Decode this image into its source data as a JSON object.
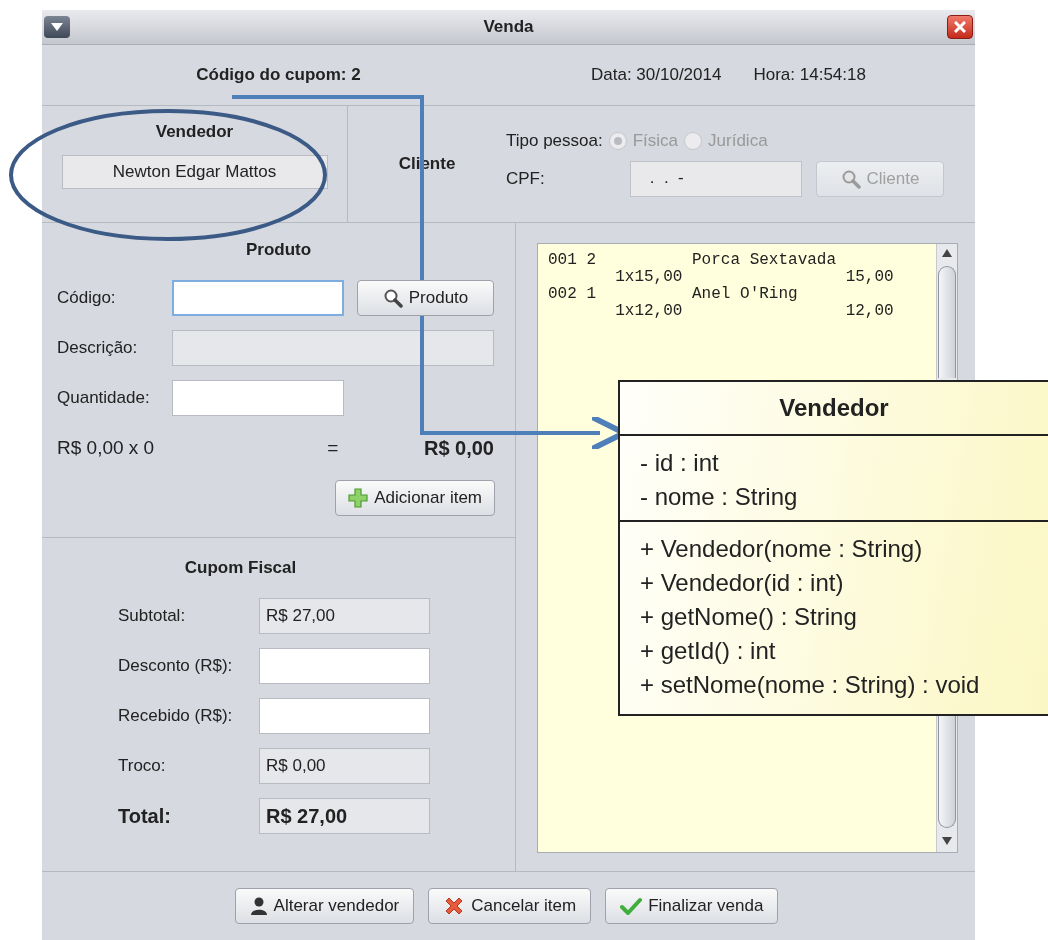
{
  "window": {
    "title": "Venda"
  },
  "header": {
    "coupon_code": "Código do cupom: 2",
    "date": "Data: 30/10/2014",
    "time": "Hora: 14:54:18"
  },
  "vendedor": {
    "title": "Vendedor",
    "value": "Newton Edgar Mattos",
    "disabled": true
  },
  "cliente": {
    "title": "Cliente",
    "person_type_label": "Tipo pessoa:",
    "disabled": true,
    "person_types": [
      {
        "label": "Física",
        "selected": true
      },
      {
        "label": "Jurídica",
        "selected": false
      }
    ],
    "cpf_label": "CPF:",
    "cpf_value": " .  .  -",
    "search_button": "Cliente"
  },
  "produto": {
    "title": "Produto",
    "search_button": "Produto",
    "fields": [
      {
        "label": "Código:",
        "disabled": false,
        "focused": true
      },
      {
        "label": "Descrição:",
        "disabled": true,
        "focused": false
      },
      {
        "label": "Quantidade:",
        "disabled": false,
        "focused": false
      }
    ],
    "formula": "R$ 0,00 x 0",
    "equals": "=",
    "result": "R$ 0,00",
    "add_button": "Adicionar item"
  },
  "cupom_fiscal": {
    "title": "Cupom Fiscal",
    "rows": [
      {
        "label": "Subtotal:",
        "value": "R$ 27,00",
        "disabled": true
      },
      {
        "label": "Desconto (R$):",
        "disabled": false
      },
      {
        "label": "Recebido (R$):",
        "disabled": false
      },
      {
        "label": "Troco:",
        "value": "R$ 0,00",
        "disabled": true
      }
    ],
    "total": {
      "label": "Total:",
      "value": "R$ 27,00"
    }
  },
  "receipt": {
    "items": [
      {
        "code": "001",
        "qty": "2",
        "description": "Porca Sextavada",
        "unit": "1x15,00",
        "total": "15,00"
      },
      {
        "code": "002",
        "qty": "1",
        "description": "Anel O'Ring",
        "unit": "1x12,00",
        "total": "12,00"
      }
    ]
  },
  "buttons": [
    {
      "label": "Alterar vendedor",
      "kind": "person"
    },
    {
      "label": "Cancelar item",
      "kind": "cross"
    },
    {
      "label": "Finalizar venda",
      "kind": "check"
    }
  ],
  "uml_class": {
    "title": "Vendedor",
    "attributes": [
      "- id : int",
      "- nome : String"
    ],
    "methods": [
      "+ Vendedor(nome : String)",
      "+ Vendedor(id : int)",
      "+ getNome() : String",
      "+ getId() : int",
      "+ setNome(nome : String) : void"
    ]
  }
}
